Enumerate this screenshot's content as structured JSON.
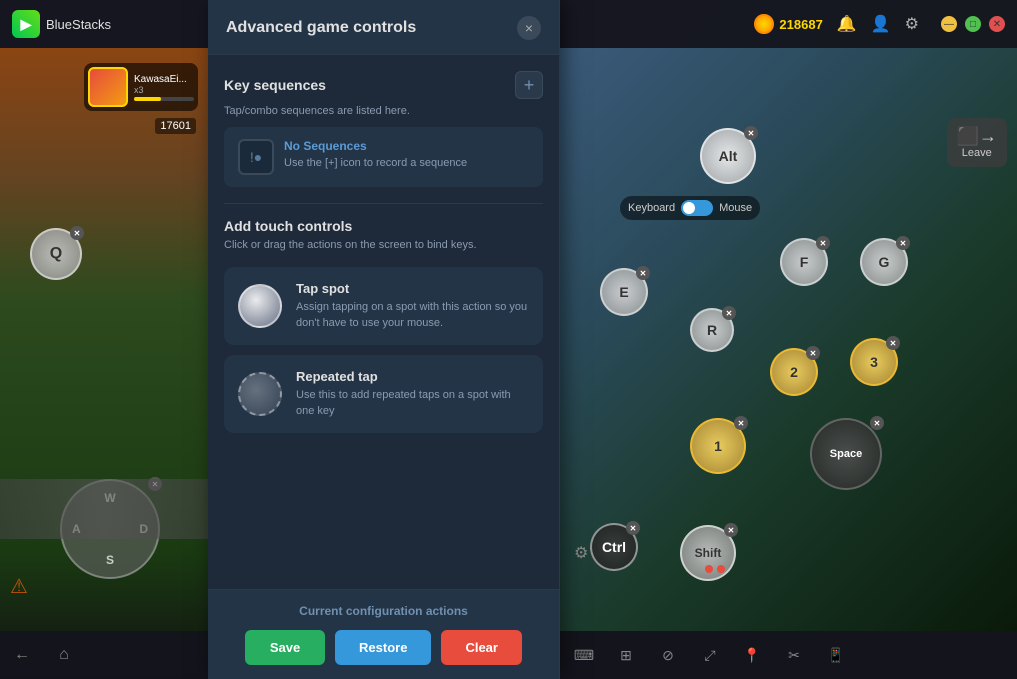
{
  "app": {
    "name": "BlueStacks",
    "title": "Advanced game controls"
  },
  "topbar": {
    "coin_amount": "218687",
    "logo_text": "BlueStacks"
  },
  "modal": {
    "title": "Advanced game controls",
    "close_label": "×",
    "key_sequences": {
      "title": "Key sequences",
      "subtitle": "Tap/combo sequences are listed here.",
      "add_btn_label": "+",
      "no_sequences": {
        "title": "No Sequences",
        "description": "Use the [+] icon to record a sequence"
      }
    },
    "touch_controls": {
      "title": "Add touch controls",
      "description": "Click or drag the actions on the screen to bind keys.",
      "tap_spot": {
        "title": "Tap spot",
        "description": "Assign tapping on a spot with this action so you don't have to use your mouse."
      },
      "repeated_tap": {
        "title": "Repeated tap",
        "description": "Use this to add repeated taps on a spot with one key"
      }
    },
    "footer": {
      "label": "Current configuration actions",
      "save_label": "Save",
      "restore_label": "Restore",
      "clear_label": "Clear"
    }
  },
  "game_controls": {
    "keys": {
      "alt": "Alt",
      "f": "F",
      "g": "G",
      "e": "E",
      "r": "R",
      "num1": "1",
      "num2": "2",
      "num3": "3",
      "space": "Space",
      "ctrl": "Ctrl",
      "shift": "Shift",
      "q": "Q"
    },
    "keyboard_label": "Keyboard",
    "mouse_label": "Mouse",
    "leave_label": "Leave"
  },
  "dpad": {
    "w": "W",
    "a": "A",
    "s": "S",
    "d": "D"
  },
  "bottom_bar_right": {
    "icons": [
      "keyboard-icon",
      "grid-icon",
      "no-entry-icon",
      "expand-icon",
      "location-icon",
      "scissors-icon",
      "phone-icon"
    ]
  }
}
